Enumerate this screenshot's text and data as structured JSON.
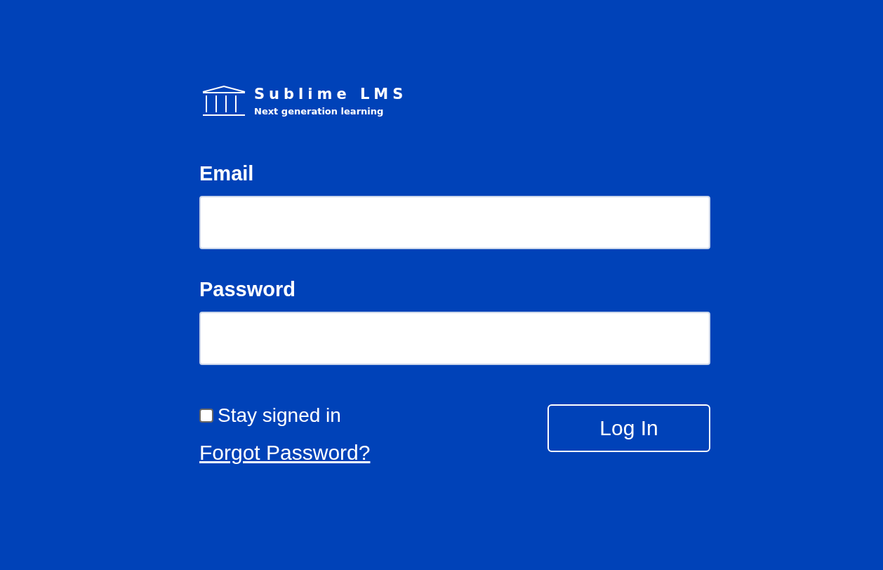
{
  "logo": {
    "title": "Sublime LMS",
    "tagline": "Next generation learning"
  },
  "fields": [
    {
      "label": "Email"
    },
    {
      "label": "Password"
    }
  ],
  "stay_signed_in": {
    "label": "Stay signed in",
    "checked": false
  },
  "forgot_link": "Forgot Password?",
  "login_button": "Log In"
}
